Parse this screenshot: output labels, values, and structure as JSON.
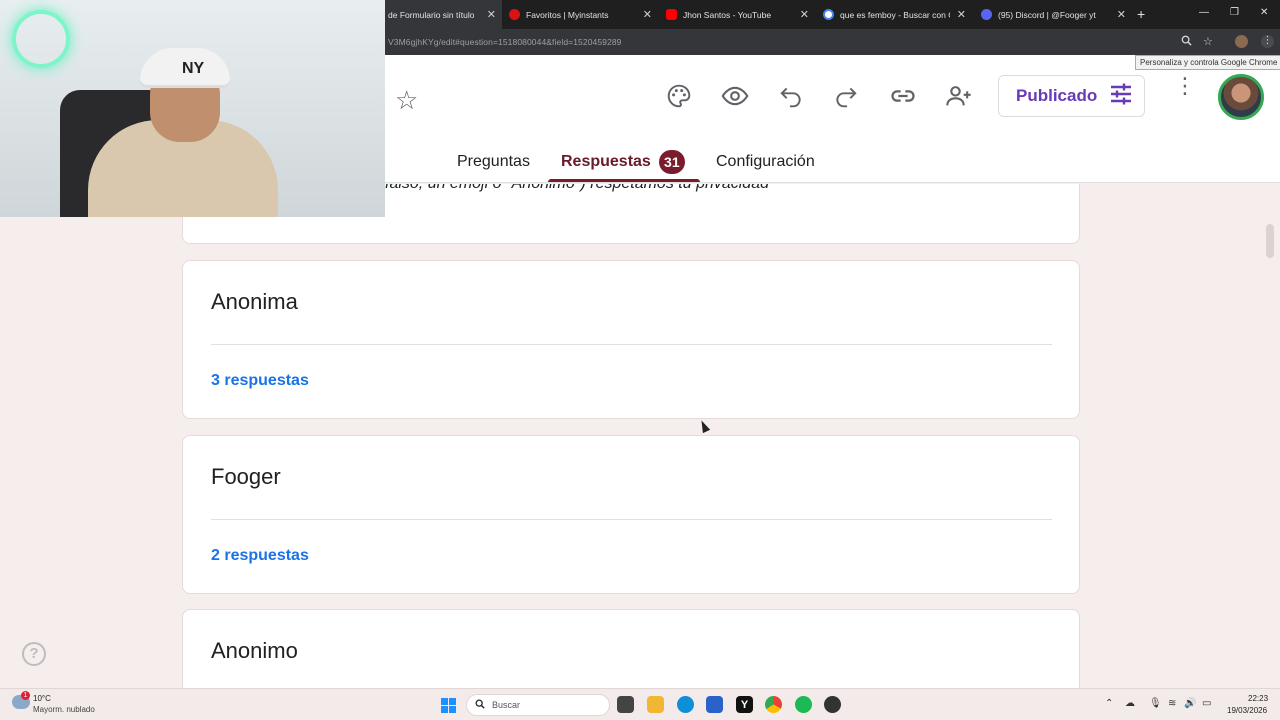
{
  "browser": {
    "tabs": [
      {
        "title": "de Formulario sin título",
        "active": true
      },
      {
        "title": "Favoritos | Myinstants",
        "active": false
      },
      {
        "title": "Jhon Santos - YouTube",
        "active": false
      },
      {
        "title": "que es femboy - Buscar con Go",
        "active": false
      },
      {
        "title": "(95) Discord | @Fooger yt",
        "active": false
      }
    ],
    "url": "V3M6gjhKYg/edit#question=1518080044&field=1520459289",
    "tooltip": "Personaliza y controla Google Chrome"
  },
  "header": {
    "publish_label": "Publicado",
    "tabs": {
      "questions": "Preguntas",
      "responses": "Respuestas",
      "responses_count": "31",
      "settings": "Configuración"
    }
  },
  "content": {
    "previous_text": "falso, un emoji o \"Anónimo\") respetamos tu privacidad",
    "cards": [
      {
        "title": "Anonima",
        "count": "3 respuestas"
      },
      {
        "title": "Fooger",
        "count": "2 respuestas"
      },
      {
        "title": "Anonimo",
        "count": ""
      }
    ]
  },
  "webcam": {
    "cap_logo": "NY"
  },
  "taskbar": {
    "weather_temp": "10°C",
    "weather_desc": "Mayorm. nublado",
    "weather_alert": "1",
    "search_placeholder": "Buscar",
    "time": "22:23",
    "date": "19/03/2026"
  },
  "colors": {
    "accent": "#7b1c2c",
    "publish": "#673ab7",
    "link": "#1a73e8",
    "page_bg": "#f6eded"
  }
}
